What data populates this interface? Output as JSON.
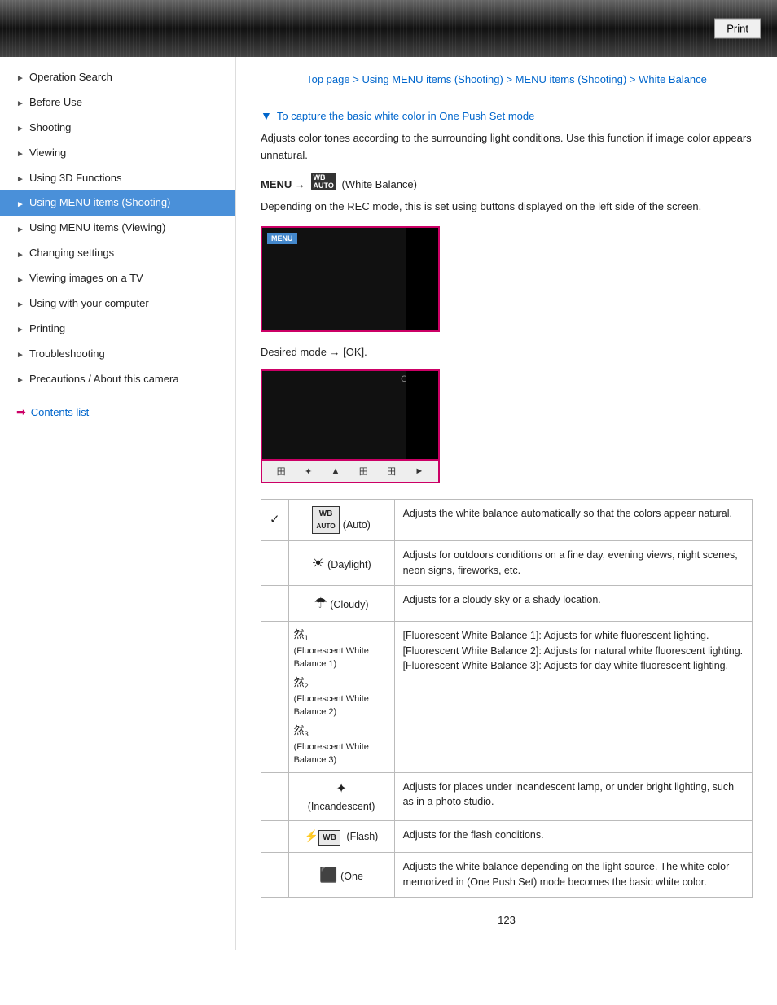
{
  "header": {
    "print_label": "Print"
  },
  "breadcrumb": {
    "top": "Top page",
    "sep1": " > ",
    "using_menu": "Using MENU items (Shooting)",
    "sep2": " > ",
    "menu_items": "MENU items (Shooting)",
    "sep3": " > ",
    "white_balance": "White Balance"
  },
  "sidebar": {
    "items": [
      {
        "id": "operation-search",
        "label": "Operation Search",
        "active": false
      },
      {
        "id": "before-use",
        "label": "Before Use",
        "active": false
      },
      {
        "id": "shooting",
        "label": "Shooting",
        "active": false
      },
      {
        "id": "viewing",
        "label": "Viewing",
        "active": false
      },
      {
        "id": "using-3d",
        "label": "Using 3D Functions",
        "active": false
      },
      {
        "id": "using-menu-shooting",
        "label": "Using MENU items (Shooting)",
        "active": true
      },
      {
        "id": "using-menu-viewing",
        "label": "Using MENU items (Viewing)",
        "active": false
      },
      {
        "id": "changing-settings",
        "label": "Changing settings",
        "active": false
      },
      {
        "id": "viewing-on-tv",
        "label": "Viewing images on a TV",
        "active": false
      },
      {
        "id": "using-computer",
        "label": "Using with your computer",
        "active": false
      },
      {
        "id": "printing",
        "label": "Printing",
        "active": false
      },
      {
        "id": "troubleshooting",
        "label": "Troubleshooting",
        "active": false
      },
      {
        "id": "precautions",
        "label": "Precautions / About this camera",
        "active": false
      }
    ],
    "contents_link": "Contents list"
  },
  "content": {
    "section_title": "To capture the basic white color in One Push Set mode",
    "desc1": "Adjusts color tones according to the surrounding light conditions. Use this function if image color appears unnatural.",
    "menu_line": "MENU → (White Balance)",
    "desc2": "Depending on the REC mode, this is set using buttons displayed on the left side of the screen.",
    "desired_mode_line": "Desired mode → [OK].",
    "table_rows": [
      {
        "check": "✓",
        "icon_label": "WB AUTO (Auto)",
        "desc": "Adjusts the white balance automatically so that the colors appear natural."
      },
      {
        "check": "",
        "icon_label": "☀ (Daylight)",
        "desc": "Adjusts for outdoors conditions on a fine day, evening views, night scenes, neon signs, fireworks, etc."
      },
      {
        "check": "",
        "icon_label": "☁ (Cloudy)",
        "desc": "Adjusts for a cloudy sky or a shady location."
      },
      {
        "check": "",
        "icon_label": "Fluorescent White Balance 1)\nFluorescent White Balance 2)\nFluorescent White Balance 3)",
        "desc": "[Fluorescent White Balance 1]: Adjusts for white fluorescent lighting.\n[Fluorescent White Balance 2]: Adjusts for natural white fluorescent lighting.\n[Fluorescent White Balance 3]: Adjusts for day white fluorescent lighting."
      },
      {
        "check": "",
        "icon_label": "✳ (Incandescent)",
        "desc": "Adjusts for places under incandescent lamp, or under bright lighting, such as in a photo studio."
      },
      {
        "check": "",
        "icon_label": "⚡WB (Flash)",
        "desc": "Adjusts for the flash conditions."
      },
      {
        "check": "",
        "icon_label": "■ (One",
        "desc": "Adjusts the white balance depending on the light source. The white color memorized in (One Push Set) mode becomes the basic white color."
      }
    ],
    "page_number": "123"
  }
}
